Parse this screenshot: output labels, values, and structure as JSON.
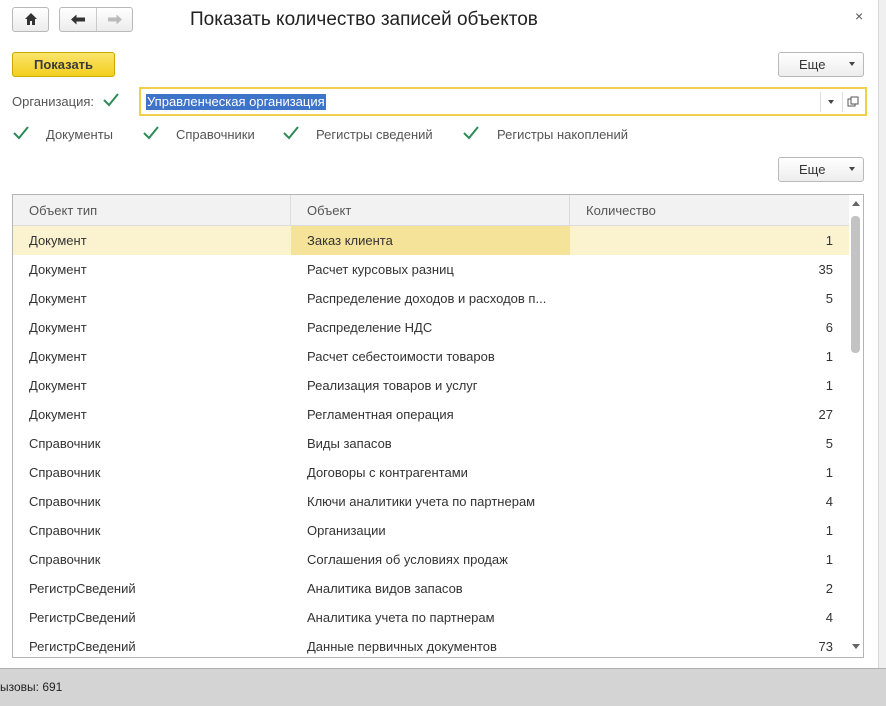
{
  "window": {
    "title": "Показать количество записей объектов",
    "close_glyph": "×"
  },
  "nav": {
    "home_icon": "home-icon",
    "back_icon": "arrow-left-icon",
    "forward_icon": "arrow-right-icon"
  },
  "toolbar": {
    "show_label": "Показать",
    "more_label": "Еще"
  },
  "organization": {
    "label": "Организация:",
    "checked": true,
    "value": "Управленческая организация"
  },
  "filters": [
    {
      "label": "Документы",
      "checked": true
    },
    {
      "label": "Справочники",
      "checked": true
    },
    {
      "label": "Регистры сведений",
      "checked": true
    },
    {
      "label": "Регистры накоплений",
      "checked": true
    }
  ],
  "table": {
    "more_label": "Еще",
    "columns": [
      "Объект тип",
      "Объект",
      "Количество"
    ],
    "rows": [
      {
        "type": "Документ",
        "object": "Заказ клиента",
        "count": "1"
      },
      {
        "type": "Документ",
        "object": "Расчет курсовых разниц",
        "count": "35"
      },
      {
        "type": "Документ",
        "object": "Распределение доходов и расходов п...",
        "count": "5"
      },
      {
        "type": "Документ",
        "object": "Распределение НДС",
        "count": "6"
      },
      {
        "type": "Документ",
        "object": "Расчет себестоимости товаров",
        "count": "1"
      },
      {
        "type": "Документ",
        "object": "Реализация товаров и услуг",
        "count": "1"
      },
      {
        "type": "Документ",
        "object": "Регламентная операция",
        "count": "27"
      },
      {
        "type": "Справочник",
        "object": "Виды запасов",
        "count": "5"
      },
      {
        "type": "Справочник",
        "object": "Договоры с контрагентами",
        "count": "1"
      },
      {
        "type": "Справочник",
        "object": "Ключи аналитики учета по партнерам",
        "count": "4"
      },
      {
        "type": "Справочник",
        "object": "Организации",
        "count": "1"
      },
      {
        "type": "Справочник",
        "object": "Соглашения об условиях продаж",
        "count": "1"
      },
      {
        "type": "РегистрСведений",
        "object": "Аналитика видов запасов",
        "count": "2"
      },
      {
        "type": "РегистрСведений",
        "object": "Аналитика учета по партнерам",
        "count": "4"
      },
      {
        "type": "РегистрСведений",
        "object": "Данные первичных документов",
        "count": "73"
      }
    ],
    "selected_row": 0
  },
  "statusbar": {
    "text": "ызовы: 691"
  },
  "colors": {
    "accent_yellow": "#f2cf1f",
    "selection_row": "#fbf3cf",
    "selection_cell": "#f6e39a",
    "check_green": "#2e8b57",
    "text_highlight": "#3d73c9"
  }
}
